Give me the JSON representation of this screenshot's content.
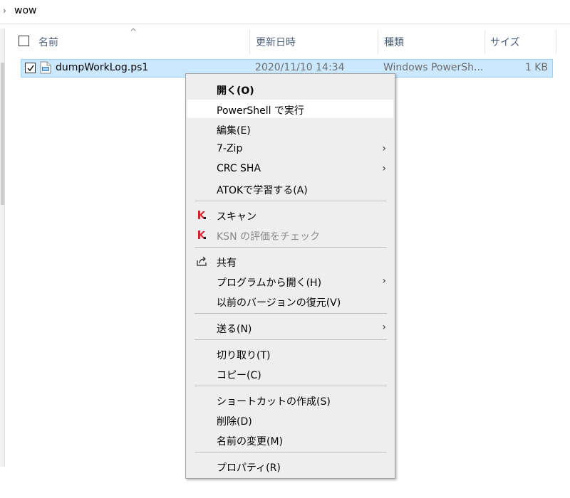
{
  "breadcrumb": {
    "chevron": "›",
    "current": "wow"
  },
  "columns": {
    "sort_indicator": "^",
    "name": "名前",
    "modified": "更新日時",
    "type": "種類",
    "size": "サイズ"
  },
  "file": {
    "name": "dumpWorkLog.ps1",
    "modified": "2020/11/10 14:34",
    "type": "Windows PowerSh...",
    "size": "1 KB",
    "checked": true
  },
  "menu": {
    "open": "開く(O)",
    "run_powershell": "PowerShell で実行",
    "edit": "編集(E)",
    "zip": "7-Zip",
    "crc": "CRC SHA",
    "atok": "ATOKで学習する(A)",
    "scan": "スキャン",
    "ksn": "KSN の評価をチェック",
    "share": "共有",
    "open_with": "プログラムから開く(H)",
    "restore": "以前のバージョンの復元(V)",
    "send_to": "送る(N)",
    "cut": "切り取り(T)",
    "copy": "コピー(C)",
    "shortcut": "ショートカットの作成(S)",
    "delete": "削除(D)",
    "rename": "名前の変更(M)",
    "properties": "プロパティ(R)",
    "submenu_arrow": "›"
  },
  "colors": {
    "selection_bg": "#cce8ff",
    "selection_border": "#99d1ff",
    "menu_bg": "#eeeeee",
    "kaspersky_red": "#e0202f"
  }
}
